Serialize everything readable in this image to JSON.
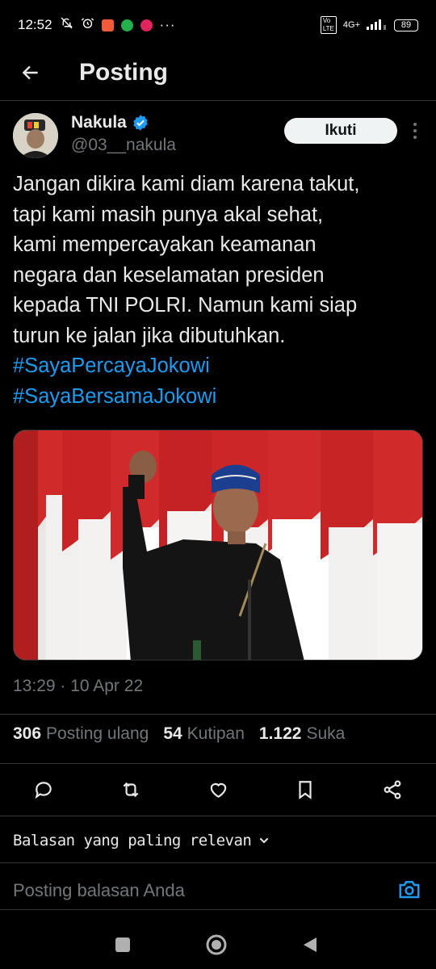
{
  "status_bar": {
    "time": "12:52",
    "network": "4G+",
    "battery": "89",
    "icons": [
      "heart-icon",
      "mute-icon",
      "alarm-icon",
      "app-orange-icon",
      "app-green-icon",
      "app-red-icon",
      "more-dots-icon",
      "volte-icon",
      "signal-icon",
      "battery-icon"
    ]
  },
  "header": {
    "title": "Posting",
    "back_icon": "arrow-left-icon"
  },
  "author": {
    "name": "Nakula",
    "handle": "@03__nakula",
    "verified_icon": "verified-badge-icon",
    "follow_label": "Ikuti",
    "more_icon": "more-vertical-icon"
  },
  "tweet": {
    "lines": [
      "Jangan dikira kami diam karena takut,",
      "tapi kami masih punya akal sehat,",
      "kami mempercayakan keamanan",
      "negara dan keselamatan presiden",
      "kepada TNI POLRI. Namun kami siap",
      "turun ke jalan jika dibutuhkan."
    ],
    "hashtags": [
      "#SayaPercayaJokowi",
      "#SayaBersamaJokowi"
    ],
    "timestamp": "13:29 · 10 Apr 22"
  },
  "stats": {
    "reposts_count": "306",
    "reposts_label": "Posting ulang",
    "quotes_count": "54",
    "quotes_label": "Kutipan",
    "likes_count": "1.122",
    "likes_label": "Suka"
  },
  "actions": [
    "reply-icon",
    "repost-icon",
    "like-icon",
    "bookmark-icon",
    "share-icon"
  ],
  "replies": {
    "sort_label": "Balasan yang paling relevan",
    "placeholder": "Posting balasan Anda"
  },
  "colors": {
    "background": "#000000",
    "text": "#e7e9ea",
    "muted": "#71767b",
    "accent": "#1d9bf0",
    "divider": "#2f3336"
  }
}
